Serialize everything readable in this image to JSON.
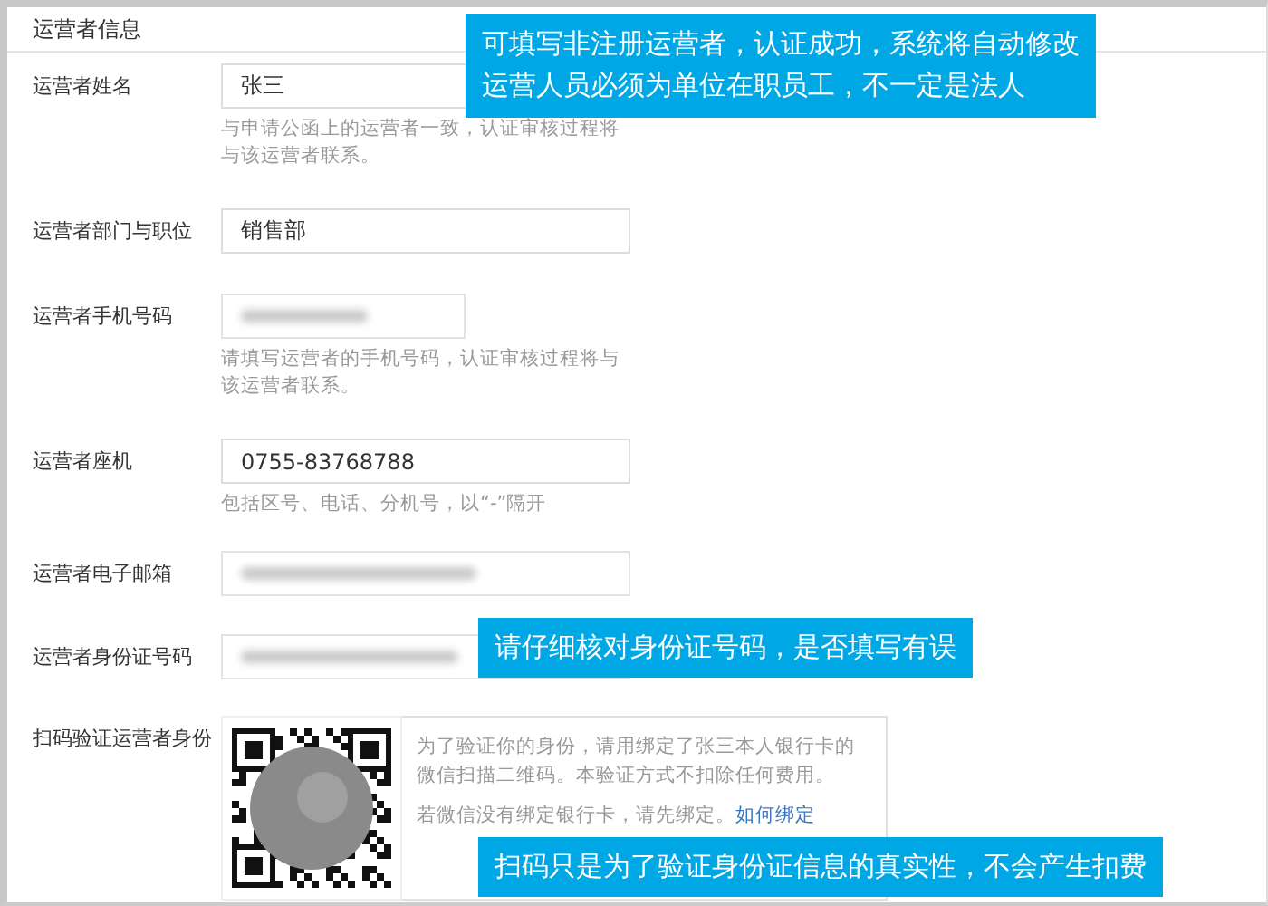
{
  "section_title": "运营者信息",
  "fields": [
    {
      "label": "运营者姓名",
      "kind": "text",
      "value": "张三",
      "hint": "与申请公函上的运营者一致，认证审核过程将与该运营者联系。"
    },
    {
      "label": "运营者部门与职位",
      "kind": "text",
      "value": "销售部"
    },
    {
      "label": "运营者手机号码",
      "kind": "blurred",
      "hint": "请填写运营者的手机号码，认证审核过程将与该运营者联系。"
    },
    {
      "label": "运营者座机",
      "kind": "text",
      "value": "0755-83768788",
      "hint": "包括区号、电话、分机号，以“-”隔开"
    },
    {
      "label": "运营者电子邮箱",
      "kind": "blurred"
    },
    {
      "label": "运营者身份证号码",
      "kind": "blurred"
    }
  ],
  "verify": {
    "label": "扫码验证运营者身份",
    "paragraphs": [
      "为了验证你的身份，请用绑定了张三本人银行卡的微信扫描二维码。本验证方式不扣除任何费用。",
      "若微信没有绑定银行卡，请先绑定。"
    ],
    "link": "如何绑定"
  },
  "callouts": [
    {
      "lines": [
        "可填写非注册运营者，认证成功，系统将自动修改",
        "运营人员必须为单位在职员工，不一定是法人"
      ]
    },
    {
      "lines": [
        "请仔细核对身份证号码，是否填写有误"
      ]
    },
    {
      "lines": [
        "扫码只是为了验证身份证信息的真实性，不会产生扣费"
      ]
    }
  ]
}
